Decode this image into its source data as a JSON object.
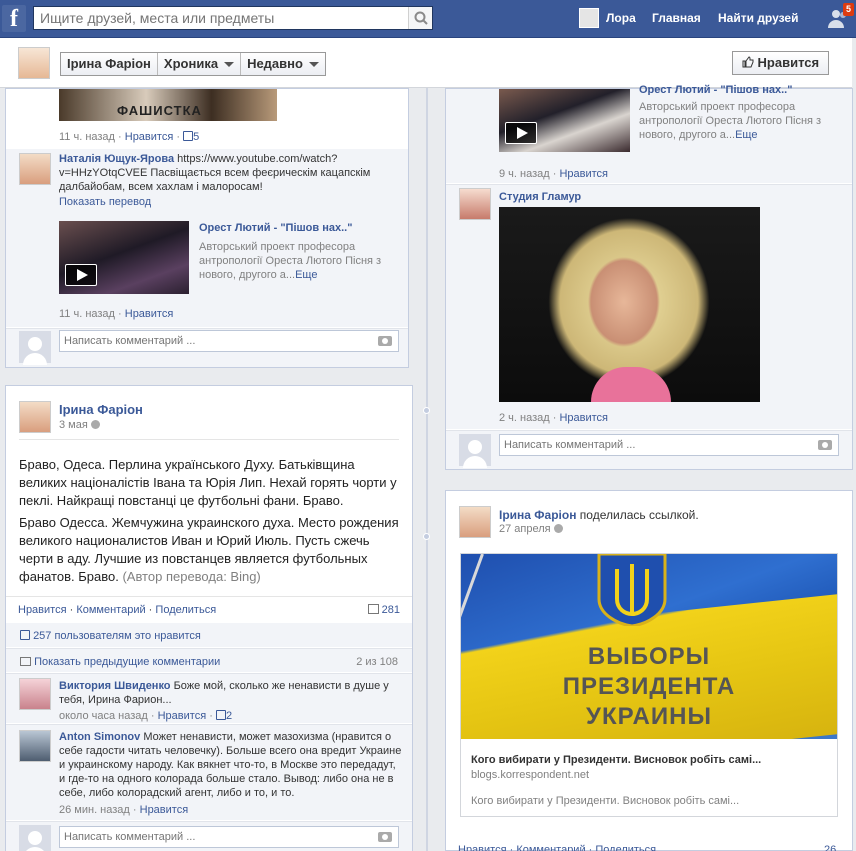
{
  "topbar": {
    "search_placeholder": "Ищите друзей, места или предметы",
    "user_name": "Лора",
    "home": "Главная",
    "find_friends": "Найти друзей",
    "notif_count": "5"
  },
  "timeline": {
    "name_tab": "Ірина Фаріон",
    "chronicle_tab": "Хроника",
    "recent_tab": "Недавно",
    "like_button": "Нравится"
  },
  "left": {
    "card1": {
      "meta_time": "11 ч. назад",
      "meta_like": "Нравится",
      "meta_count": "5",
      "comment_author": "Наталія Ющук-Ярова",
      "comment_text": " https://www.youtube.com/watch?v=HHzYOtqCVEE Пасвіщається всем феєрическім кацапскім далбайобам, всем хахлам і малоросам!",
      "show_translation": "Показать перевод",
      "video_title": "Орест Лютий - \"Пішов нах..\"",
      "video_desc": "Авторський проект професора антропології Ореста Лютого Пісня з нового, другого а...",
      "video_more": "Еще",
      "comment_time": "11 ч. назад",
      "comment_like": "Нравится",
      "comment_placeholder": "Написать комментарий ..."
    },
    "card2": {
      "author": "Ірина Фаріон",
      "date": "3 мая",
      "text_uk": "Браво, Одеса. Перлина українського Духу. Батьківщина великих націоналістів Івана та Юрія Лип. Нехай горять чорти у пеклі. Найкращі повстанці це футбольні фани. Браво.",
      "text_ru": "Браво Одесса. Жемчужина украинского духа. Место рождения великого националистов Иван и Юрий Июль. Пусть сжечь черти в аду. Лучшие из повстанцев является футбольных фанатов. Браво.",
      "translation_note": "(Автор перевода: Bing)",
      "actions": [
        "Нравится",
        "Комментарий",
        "Поделиться"
      ],
      "share_count": "281",
      "likes_text": "257 пользователям это нравится",
      "prev_comments": "Показать предыдущие комментарии",
      "prev_count": "2 из 108",
      "c1_author": "Виктория Швиденко",
      "c1_text": " Боже мой, сколько же ненависти в душе у тебя, Ирина Фарион...",
      "c1_time": "около часа назад",
      "c1_like": "Нравится",
      "c1_count": "2",
      "c2_author": "Anton Simonov",
      "c2_text": " Может ненависти, может мазохизма (нравится о себе гадости читать человечку). Больше всего она вредит Украине и украинскому народу. Как вякнет что-то, в Москве это передадут, и где-то на одного колорада больше стало. Вывод: либо она не в себе, либо колорадский агент, либо и то, и то.",
      "c2_time": "26 мин. назад",
      "c2_like": "Нравится",
      "comment_placeholder": "Написать комментарий ..."
    }
  },
  "right": {
    "card1": {
      "video_title_cut": "Орест Лютий - \"Пішов нах..\"",
      "video_desc": "Авторський проект професора антропології Ореста Лютого Пісня з нового, другого а...",
      "video_more": "Еще",
      "time": "9 ч. назад",
      "like": "Нравится",
      "sub_author": "Студия Гламур",
      "sub_time": "2 ч. назад",
      "sub_like": "Нравится",
      "comment_placeholder": "Написать комментарий ..."
    },
    "card2": {
      "author": "Ірина Фаріон",
      "action": " поделилась ссылкой.",
      "date": "27 апреля",
      "image_text_1": "ВЫБОРЫ",
      "image_text_2": "ПРЕЗИДЕНТА",
      "image_text_3": "УКРАИНЫ",
      "link_title": "Кого вибирати у Президенти. Висновок робіть самі...",
      "link_domain": "blogs.korrespondent.net",
      "link_desc": "Кого вибирати у Президенти. Висновок робіть самі...",
      "bottom_actions": "Нравится · Комментарий · Поделиться",
      "bottom_count": "26"
    }
  },
  "colors": {
    "brand": "#3b5998",
    "link": "#3b5998",
    "badge": "#dd3c10",
    "flag_blue": "#1f5fbf",
    "flag_yellow": "#f2d21a"
  }
}
